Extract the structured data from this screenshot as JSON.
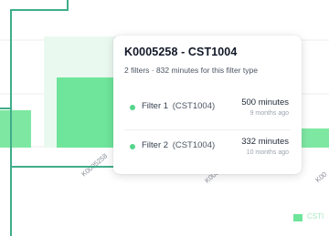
{
  "chart_data": {
    "type": "bar",
    "categories": [
      "K0005258",
      "K000",
      "K00"
    ],
    "values": [
      null,
      null,
      null
    ],
    "legend": [
      "CSTI"
    ],
    "grid": true,
    "colors": {
      "bar": "#7ee8a2",
      "hover_band": "#eaf9f0",
      "grid": "#ececec",
      "outline": "#3fae8a"
    }
  },
  "tooltip": {
    "title": "K0005258 - CST1004",
    "summary": "2 filters · 832 minutes for this filter type",
    "rows": [
      {
        "label": "Filter 1",
        "code": "(CST1004)",
        "minutes": "500 minutes",
        "ago": "9 months ago"
      },
      {
        "label": "Filter 2",
        "code": "(CST1004)",
        "minutes": "332 minutes",
        "ago": "10 months ago"
      }
    ],
    "dot_color": "#55d58c"
  }
}
